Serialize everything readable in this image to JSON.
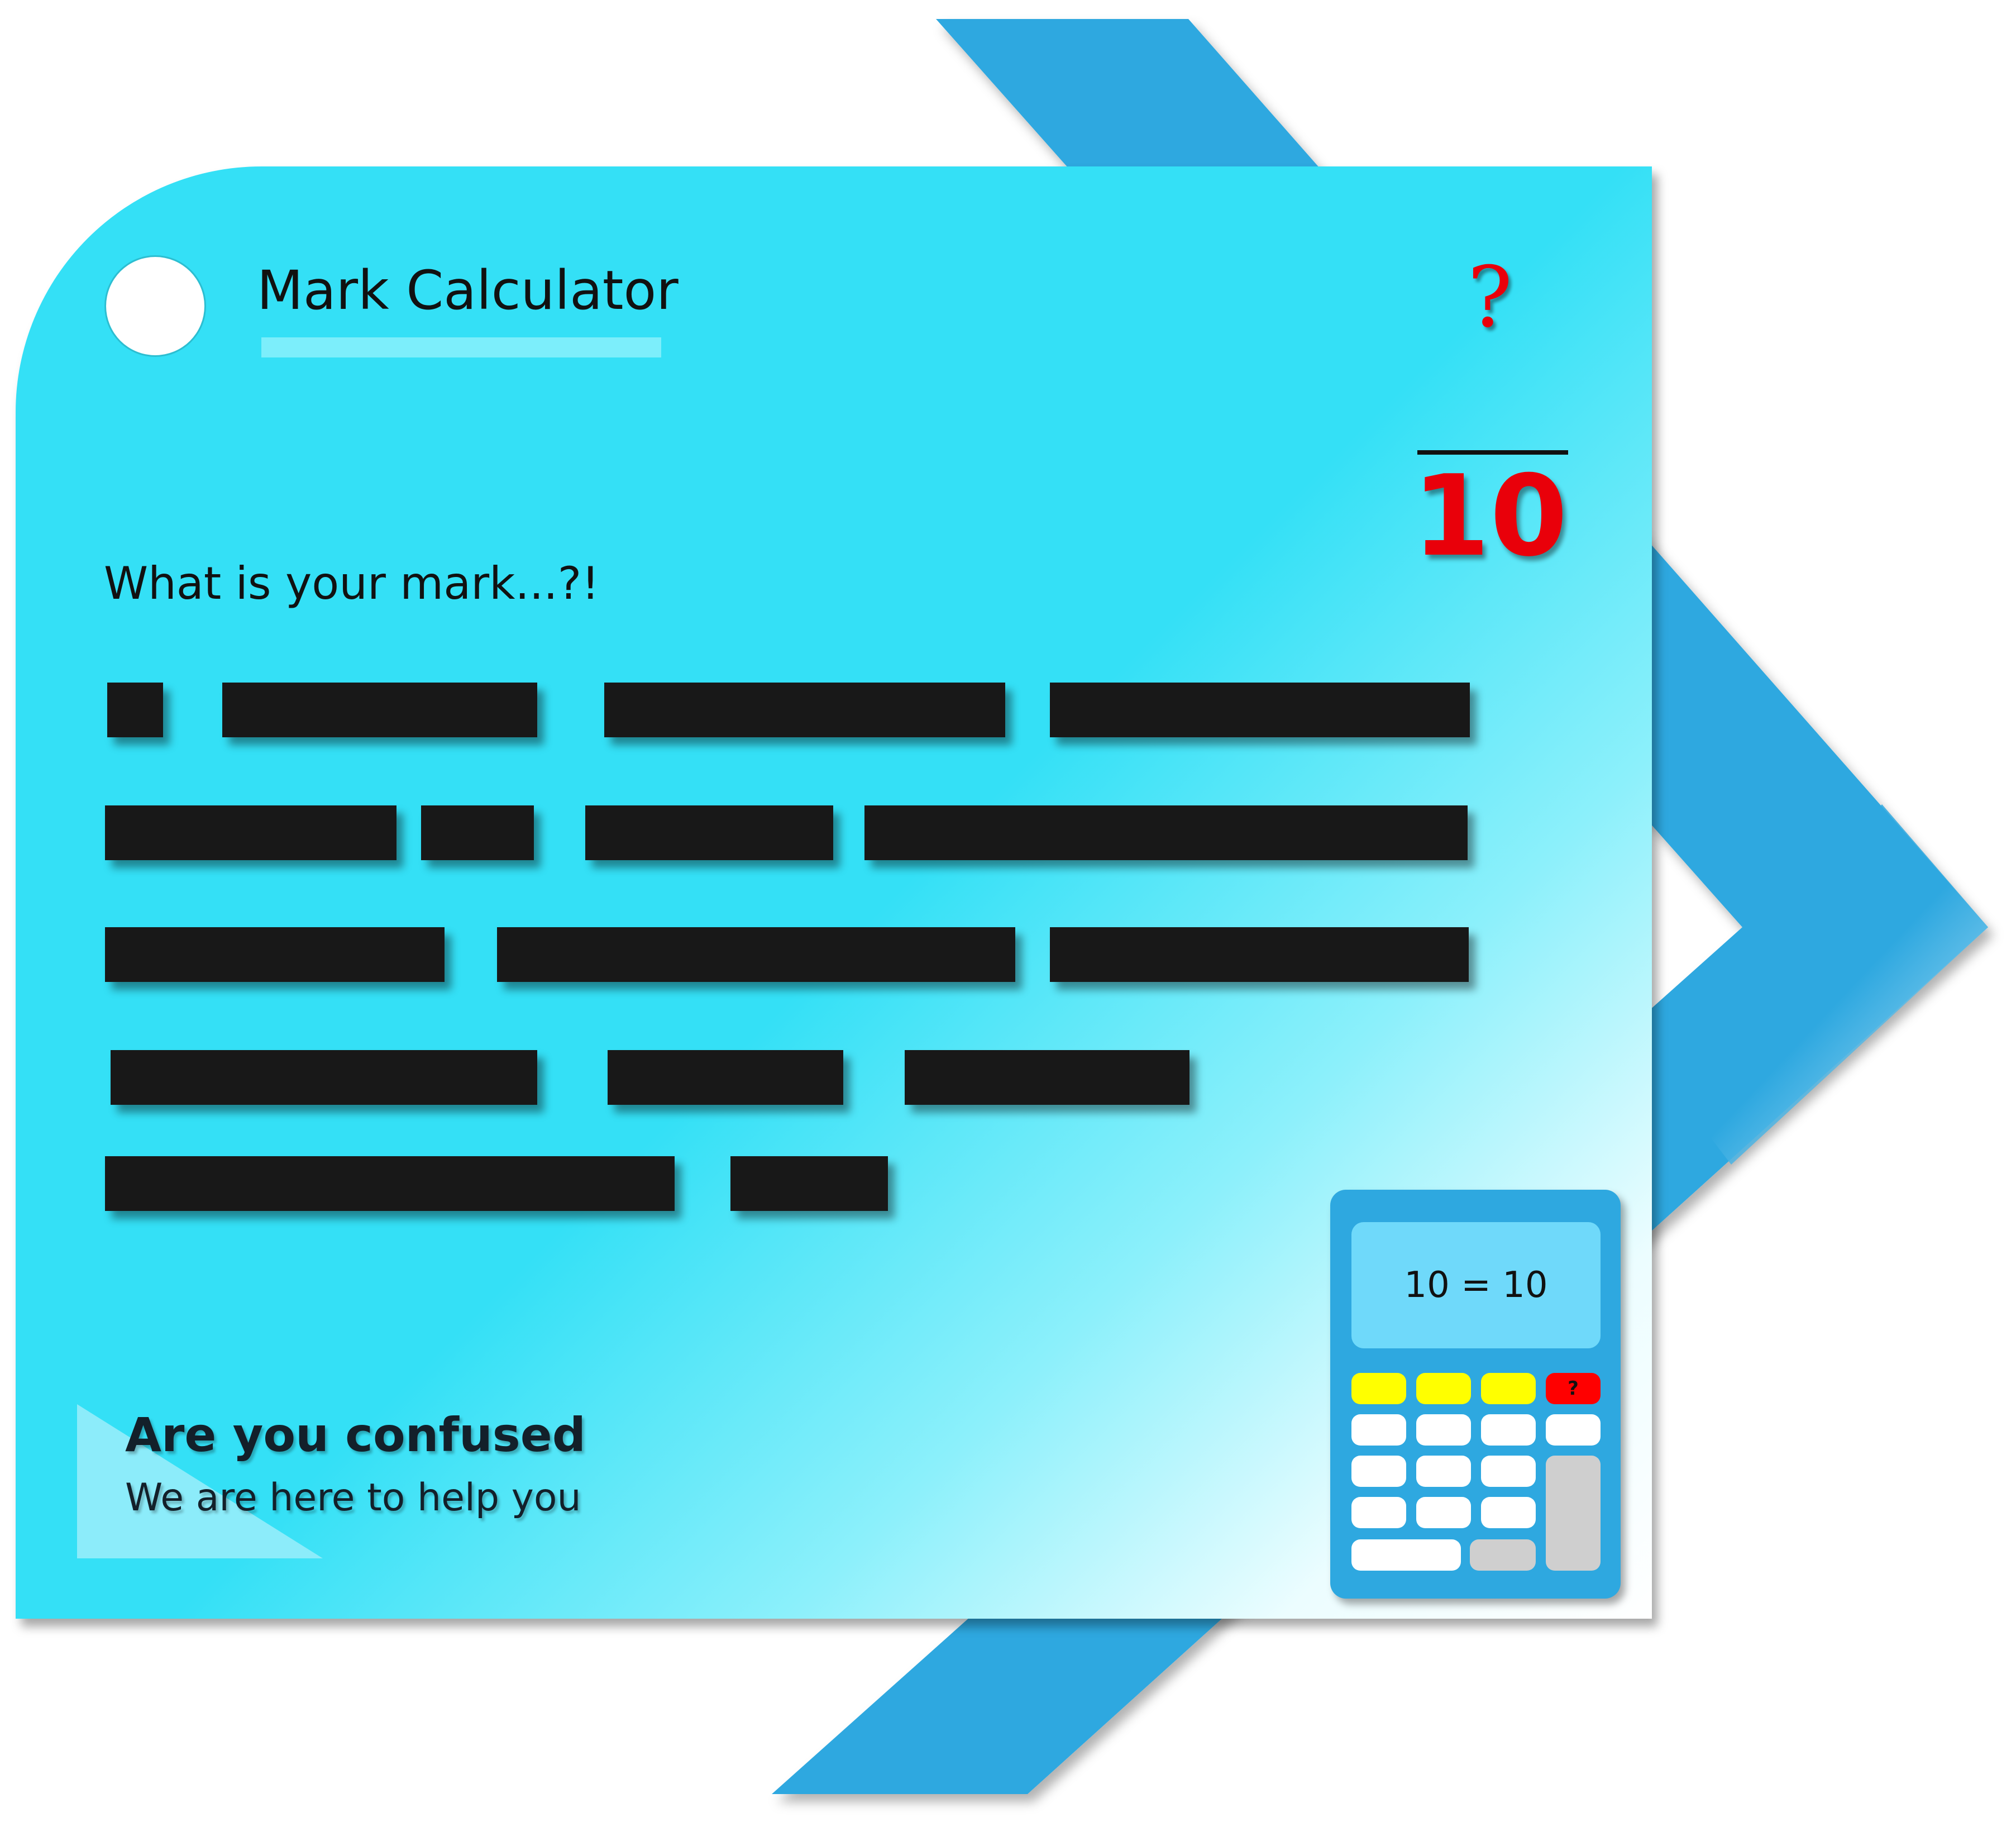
{
  "app": {
    "title": "Mark Calculator",
    "question": "What is your mark...?!"
  },
  "score": {
    "numerator": "?",
    "denominator": "10"
  },
  "help": {
    "title": "Are you confused",
    "subtitle": "We are here to help you"
  },
  "calculator": {
    "display": "10 = 10",
    "help_key": "?"
  },
  "colors": {
    "card": "#34e0f6",
    "chevron": "#2ea8e0",
    "score": "#e9000a",
    "redaction": "#181818"
  }
}
